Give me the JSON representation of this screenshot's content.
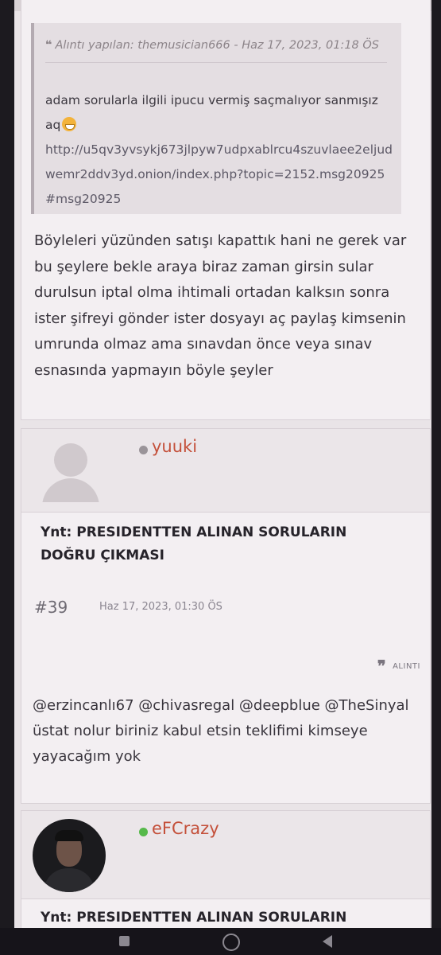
{
  "quote": {
    "header": "Alıntı yapılan: themusician666 - Haz 17, 2023, 01:18 ÖS",
    "text": "adam sorularla ilgili ipucu vermiş saçmalıyor sanmışız aq",
    "emoji_icon": "grinning-face-icon",
    "link": "http://u5qv3yvsykj673jlpyw7udpxablrcu4szuvlaee2eljudwemr2ddv3yd.onion/index.php?topic=2152.msg20925#msg20925"
  },
  "post1": {
    "body": "Böyleleri yüzünden satışı kapattık hani ne gerek var bu şeylere bekle araya biraz zaman girsin sular durulsun iptal olma ihtimali ortadan kalksın sonra ister şifreyi gönder ister dosyayı aç paylaş kimsenin umrunda olmaz ama sınavdan önce veya sınav esnasında yapmayın böyle şeyler"
  },
  "post2": {
    "username": "yuuki",
    "status_color": "#9a9499",
    "username_color": "#c4503a",
    "title": "Ynt: PRESIDENTTEN ALINAN SORULARIN DOĞRU ÇIKMASI",
    "number": "#39",
    "date": "Haz 17, 2023, 01:30 ÖS",
    "quote_button": "ALINTI",
    "body": "@erzincanlı67 @chivasregal @deepblue @TheSinyal üstat nolur biriniz kabul etsin teklifimi kimseye yayacağım yok"
  },
  "post3": {
    "username": "eFCrazy",
    "status_color": "#56b94a",
    "username_color": "#c4503a",
    "title": "Ynt: PRESIDENTTEN ALINAN SORULARIN"
  }
}
